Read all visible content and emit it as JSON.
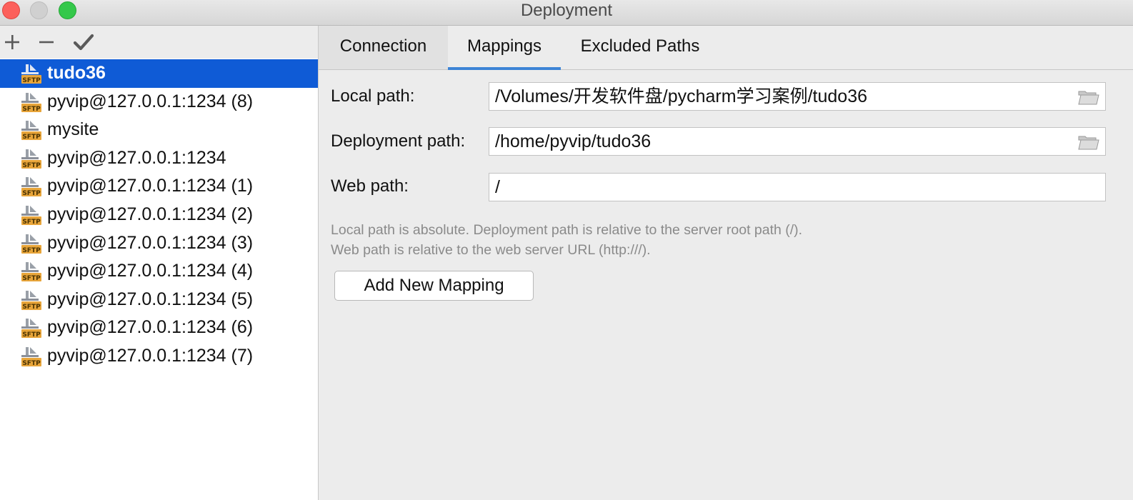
{
  "window": {
    "title": "Deployment"
  },
  "toolbar": {
    "add_icon": "plus-icon",
    "remove_icon": "minus-icon",
    "apply_icon": "checkmark-icon"
  },
  "servers": [
    {
      "label": "tudo36",
      "icon": "sftp-icon",
      "selected": true
    },
    {
      "label": "pyvip@127.0.0.1:1234 (8)",
      "icon": "sftp-icon"
    },
    {
      "label": "mysite",
      "icon": "sftp-icon"
    },
    {
      "label": "pyvip@127.0.0.1:1234",
      "icon": "sftp-icon"
    },
    {
      "label": "pyvip@127.0.0.1:1234 (1)",
      "icon": "sftp-icon"
    },
    {
      "label": "pyvip@127.0.0.1:1234 (2)",
      "icon": "sftp-icon"
    },
    {
      "label": "pyvip@127.0.0.1:1234 (3)",
      "icon": "sftp-icon"
    },
    {
      "label": "pyvip@127.0.0.1:1234 (4)",
      "icon": "sftp-icon"
    },
    {
      "label": "pyvip@127.0.0.1:1234 (5)",
      "icon": "sftp-icon"
    },
    {
      "label": "pyvip@127.0.0.1:1234 (6)",
      "icon": "sftp-icon"
    },
    {
      "label": "pyvip@127.0.0.1:1234 (7)",
      "icon": "sftp-icon"
    }
  ],
  "tabs": {
    "connection": "Connection",
    "mappings": "Mappings",
    "excluded": "Excluded Paths",
    "active": "Mappings"
  },
  "mappings": {
    "local_path_label": "Local path:",
    "local_path_value": "/Volumes/开发软件盘/pycharm学习案例/tudo36",
    "deployment_path_label": "Deployment path:",
    "deployment_path_value": "/home/pyvip/tudo36",
    "web_path_label": "Web path:",
    "web_path_value": "/",
    "hint_line1": "Local path is absolute. Deployment path is relative to the server root path (/).",
    "hint_line2": "Web path is relative to the web server URL (http:///).",
    "add_button": "Add New Mapping"
  },
  "colors": {
    "selection": "#0f5bd6",
    "tab_underline": "#3d84d6",
    "sftp_badge": "#e8a53a"
  }
}
